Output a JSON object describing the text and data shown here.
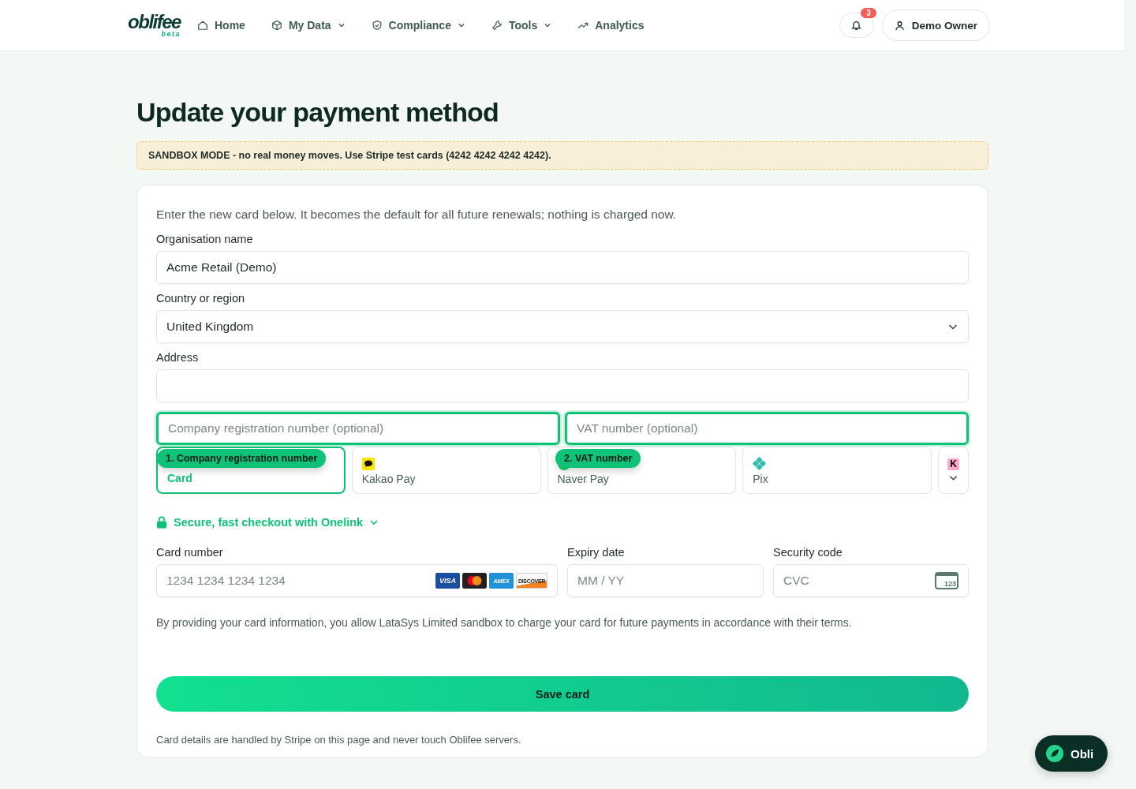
{
  "header": {
    "logo": {
      "name": "oblifee",
      "tag": "beta"
    },
    "nav": [
      {
        "kind": "home",
        "label": "Home",
        "dropdown": false
      },
      {
        "kind": "box",
        "label": "My Data",
        "dropdown": true
      },
      {
        "kind": "shield",
        "label": "Compliance",
        "dropdown": true
      },
      {
        "kind": "wrench",
        "label": "Tools",
        "dropdown": true
      },
      {
        "kind": "trend",
        "label": "Analytics",
        "dropdown": false
      }
    ],
    "notifications": {
      "count": "3"
    },
    "user": {
      "name": "Demo Owner"
    }
  },
  "page": {
    "title": "Update your payment method",
    "notice": "**SANDBOX MODE** - no real money moves. Use Stripe test cards (4242 4242 4242 4242).",
    "intro": "Enter the new card below. It becomes the default for all future renewals; nothing is charged now.",
    "fields": [
      {
        "kind": "text",
        "label": "Organisation name",
        "value": "Acme Retail (Demo)"
      },
      {
        "kind": "select",
        "label": "Country or region",
        "value": "United Kingdom"
      },
      {
        "kind": "text",
        "label": "Address"
      }
    ],
    "optional_fields": [
      {
        "placeholder": "Company registration number (optional)",
        "highlighted": true
      },
      {
        "placeholder": "VAT number (optional)",
        "highlighted": true
      }
    ],
    "methods": [
      {
        "kind": "card",
        "label": "Card",
        "selected": true
      },
      {
        "kind": "kakao",
        "label": "Kakao Pay",
        "selected": false
      },
      {
        "kind": "naver",
        "label": "Naver Pay",
        "selected": false
      },
      {
        "kind": "pix",
        "label": "Pix",
        "selected": false
      },
      {
        "kind": "more",
        "icon_text": "K",
        "selected": false
      }
    ],
    "tour_steps": [
      {
        "label": "1. Company registration number"
      },
      {
        "label": "2. VAT number"
      }
    ],
    "onelink": "Secure, fast checkout with Onelink",
    "card": {
      "number_label": "Card number",
      "number_placeholder": "1234 1234 1234 1234",
      "brands": [
        {
          "kind": "visa",
          "label": "VISA"
        },
        {
          "kind": "mastercard"
        },
        {
          "kind": "amex",
          "label": "AMEX"
        },
        {
          "kind": "discover",
          "label": "DISCOVER"
        }
      ],
      "expiry_label": "Expiry date",
      "expiry_placeholder": "MM / YY",
      "cvc_label": "Security code",
      "cvc_placeholder": "CVC",
      "cvc_icon_text": "123"
    },
    "consent": "By providing your card information, you allow LataSys Limited sandbox to charge your card for future payments in accordance with their terms.",
    "save": "Save card",
    "footnote": "Card details are handled by Stripe on this page and never touch Oblifee servers."
  },
  "assistant": {
    "label": "Obli"
  }
}
